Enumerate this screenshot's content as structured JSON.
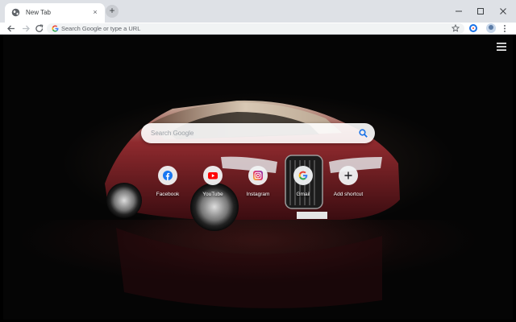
{
  "browser": {
    "tab": {
      "title": "New Tab",
      "close_glyph": "×",
      "icon": "globe-icon"
    },
    "newtab_glyph": "+",
    "window_controls": [
      "minimize-icon",
      "maximize-icon",
      "close-icon"
    ],
    "omnibox": {
      "placeholder": "Search Google or type a URL",
      "value": ""
    }
  },
  "page": {
    "search": {
      "placeholder": "Search Google"
    },
    "shortcuts": [
      {
        "label": "Facebook",
        "icon": "facebook-icon",
        "color": "#1877f2"
      },
      {
        "label": "YouTube",
        "icon": "youtube-icon",
        "color": "#ff0000"
      },
      {
        "label": "Instagram",
        "icon": "instagram-icon",
        "color": "#d6249f"
      },
      {
        "label": "Gmail",
        "icon": "google-icon",
        "color": "#4285f4"
      },
      {
        "label": "Add shortcut",
        "icon": "plus-icon",
        "color": "#202124"
      }
    ]
  },
  "colors": {
    "accent": "#1a73e8",
    "tabstrip": "#dee1e6"
  }
}
